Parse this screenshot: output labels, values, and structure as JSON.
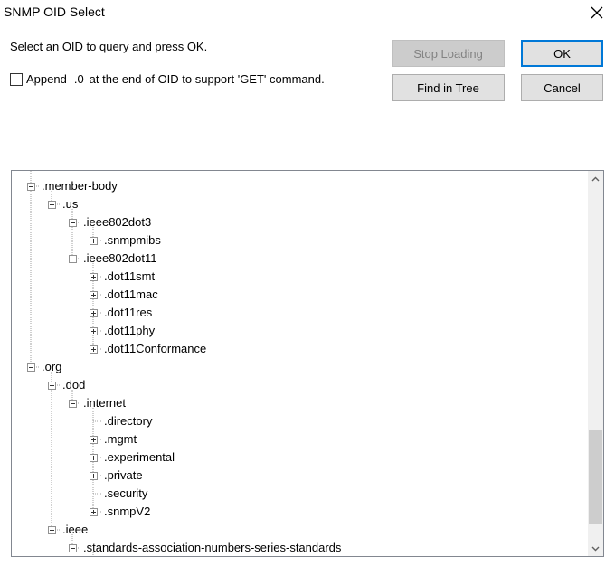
{
  "window": {
    "title": "SNMP OID Select",
    "close_icon": "close-icon"
  },
  "instruction": "Select an OID to query and press OK.",
  "append_option": {
    "checked": false,
    "prefix": "Append",
    "suffix_code": ".0",
    "rest": "at the end of OID to support 'GET' command."
  },
  "buttons": {
    "stop_loading": "Stop Loading",
    "ok": "OK",
    "find_in_tree": "Find in Tree",
    "cancel": "Cancel"
  },
  "tree": {
    "nodes": [
      {
        "label": ".member-body",
        "depth": 0,
        "expander": "minus"
      },
      {
        "label": ".us",
        "depth": 1,
        "expander": "minus"
      },
      {
        "label": ".ieee802dot3",
        "depth": 2,
        "expander": "minus"
      },
      {
        "label": ".snmpmibs",
        "depth": 3,
        "expander": "plus"
      },
      {
        "label": ".ieee802dot11",
        "depth": 2,
        "expander": "minus"
      },
      {
        "label": ".dot11smt",
        "depth": 3,
        "expander": "plus"
      },
      {
        "label": ".dot11mac",
        "depth": 3,
        "expander": "plus"
      },
      {
        "label": ".dot11res",
        "depth": 3,
        "expander": "plus"
      },
      {
        "label": ".dot11phy",
        "depth": 3,
        "expander": "plus"
      },
      {
        "label": ".dot11Conformance",
        "depth": 3,
        "expander": "plus"
      },
      {
        "label": ".org",
        "depth": 0,
        "expander": "minus"
      },
      {
        "label": ".dod",
        "depth": 1,
        "expander": "minus"
      },
      {
        "label": ".internet",
        "depth": 2,
        "expander": "minus"
      },
      {
        "label": ".directory",
        "depth": 3,
        "expander": "none"
      },
      {
        "label": ".mgmt",
        "depth": 3,
        "expander": "plus"
      },
      {
        "label": ".experimental",
        "depth": 3,
        "expander": "plus"
      },
      {
        "label": ".private",
        "depth": 3,
        "expander": "plus"
      },
      {
        "label": ".security",
        "depth": 3,
        "expander": "none"
      },
      {
        "label": ".snmpV2",
        "depth": 3,
        "expander": "plus"
      },
      {
        "label": ".ieee",
        "depth": 1,
        "expander": "minus"
      },
      {
        "label": ".standards-association-numbers-series-standards",
        "depth": 2,
        "expander": "minus"
      }
    ]
  },
  "scrollbar": {
    "up_icon": "chevron-up-icon",
    "down_icon": "chevron-down-icon"
  },
  "colors": {
    "default_button_border": "#0078d7",
    "button_face": "#e1e1e1",
    "disabled_text": "#838383"
  }
}
